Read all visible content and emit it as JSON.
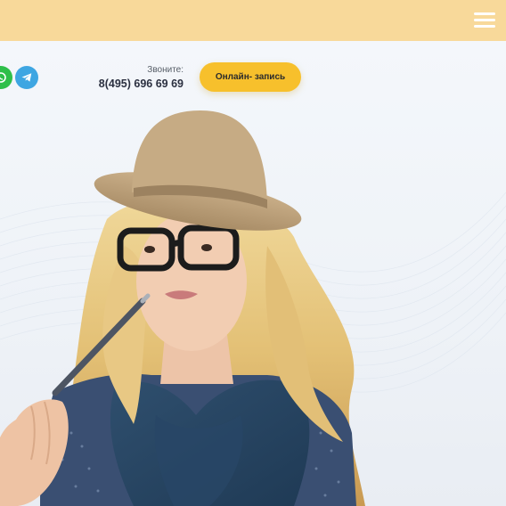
{
  "header": {
    "menu_icon": "hamburger-menu-icon",
    "bar_color": "#f8d99a"
  },
  "contacts": {
    "whatsapp_icon": "whatsapp-icon",
    "telegram_icon": "telegram-icon",
    "call_label": "Звоните:",
    "phone": "8(495) 696 69 69"
  },
  "cta": {
    "label": "Онлайн- запись",
    "color": "#f7c02c"
  },
  "hero": {
    "image": "woman-in-hat-and-glasses-holding-pen"
  }
}
